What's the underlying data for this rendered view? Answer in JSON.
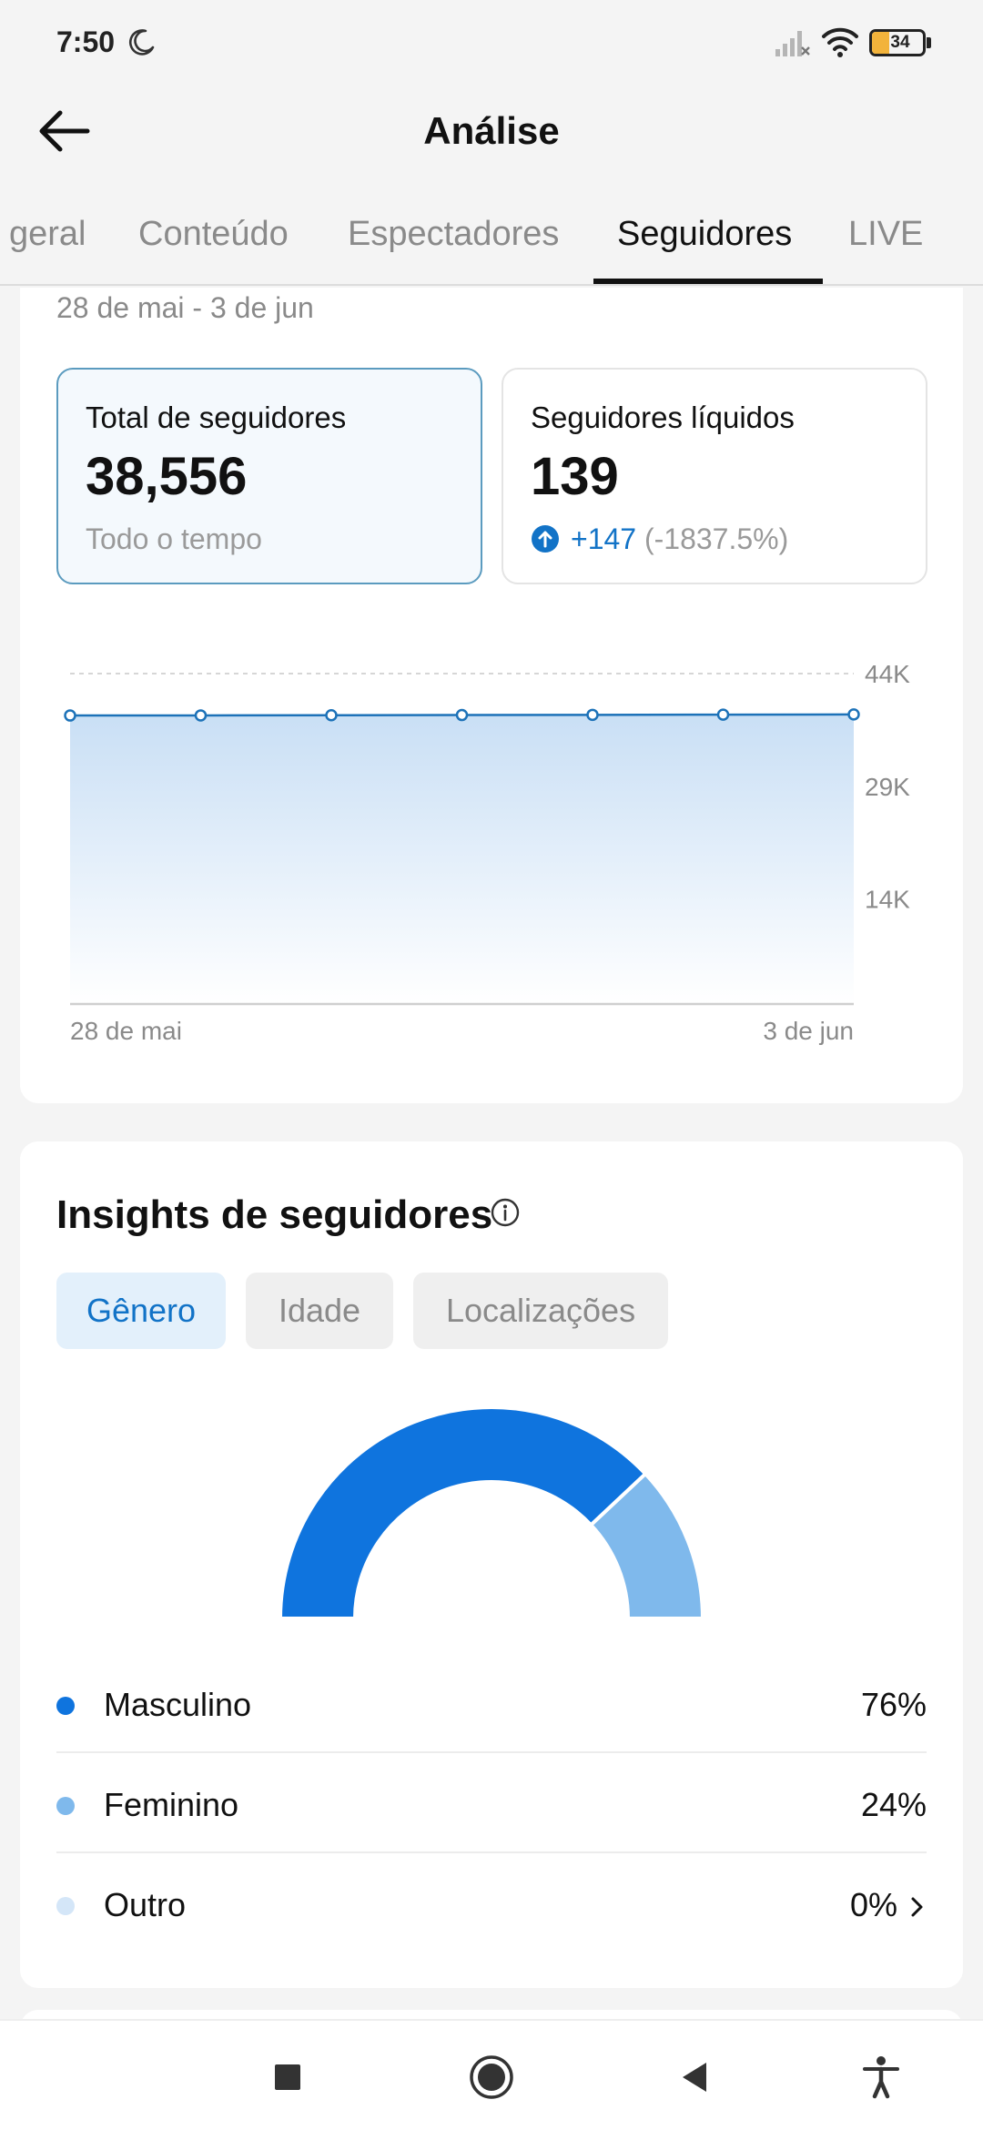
{
  "status_bar": {
    "time": "7:50",
    "battery_level": "34",
    "battery_fraction": 0.34,
    "icons": [
      "moon-icon",
      "signal-icon",
      "wifi-icon",
      "battery-icon"
    ]
  },
  "header": {
    "title": "Análise",
    "back_icon": "arrow-left-icon"
  },
  "tabs": [
    {
      "label": "geral",
      "active": false
    },
    {
      "label": "Conteúdo",
      "active": false
    },
    {
      "label": "Espectadores",
      "active": false
    },
    {
      "label": "Seguidores",
      "active": true
    },
    {
      "label": "LIVE",
      "active": false
    }
  ],
  "overview": {
    "date_range": "28 de mai - 3 de jun",
    "metrics": [
      {
        "label": "Total de seguidores",
        "value": "38,556",
        "sub": "Todo o tempo",
        "selected": true
      },
      {
        "label": "Seguidores líquidos",
        "value": "139",
        "change_value": "+147",
        "change_pct": "(-1837.5%)",
        "selected": false
      }
    ]
  },
  "chart_data": {
    "type": "area",
    "x_labels": [
      "28 de mai",
      "3 de jun"
    ],
    "y_ticks": [
      "44K",
      "29K",
      "14K"
    ],
    "y_tick_values": [
      44000,
      29000,
      14000
    ],
    "ylim": [
      0,
      44000
    ],
    "series": [
      {
        "values": [
          38417,
          38430,
          38450,
          38480,
          38505,
          38530,
          38556
        ]
      }
    ],
    "grid": true,
    "colors": {
      "line": "#1d72b8",
      "fill_top": "#c9dff5",
      "fill_bottom": "#ffffff"
    }
  },
  "insights": {
    "title": "Insights de seguidores",
    "info_icon": "info-icon",
    "chips": [
      {
        "label": "Gênero",
        "active": true
      },
      {
        "label": "Idade",
        "active": false
      },
      {
        "label": "Localizações",
        "active": false
      }
    ],
    "gender_chart": {
      "type": "pie",
      "style": "half-donut",
      "slices": [
        {
          "label": "Masculino",
          "value": 76,
          "color": "#0f74de"
        },
        {
          "label": "Feminino",
          "value": 24,
          "color": "#7fb9ec"
        },
        {
          "label": "Outro",
          "value": 0,
          "color": "#d4e6f8"
        }
      ]
    },
    "legend": [
      {
        "label": "Masculino",
        "value": "76%",
        "color": "#0f74de"
      },
      {
        "label": "Feminino",
        "value": "24%",
        "color": "#7fb9ec"
      },
      {
        "label": "Outro",
        "value": "0%",
        "color": "#d4e6f8",
        "chevron": true
      }
    ]
  },
  "nav_bar": {
    "icons": [
      "recents-square-icon",
      "home-circle-icon",
      "back-triangle-icon",
      "accessibility-icon"
    ]
  }
}
